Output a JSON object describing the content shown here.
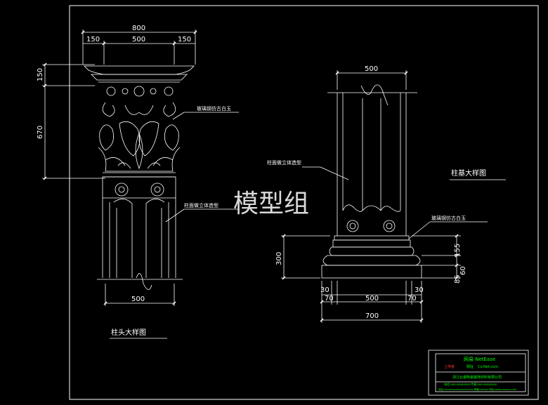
{
  "watermark": "模型组",
  "capital": {
    "dims_top": {
      "total": "800",
      "left": "150",
      "center": "500",
      "right": "150"
    },
    "dims_left": {
      "top": "150",
      "bottom": "670"
    },
    "dim_bottom": "500",
    "note_ornament": "玻璃钢仿古白玉",
    "note_shaft": "柱面做立体造型",
    "title": "柱头大样图"
  },
  "base": {
    "dim_top": "500",
    "note_shaft": "柱面做立体造型",
    "note_ring": "玻璃钢仿古白玉",
    "dims_right": {
      "a": "155",
      "b": "60",
      "c": "85"
    },
    "dim_left": "300",
    "dims_bottom_row1": {
      "l": "30",
      "r": "30"
    },
    "dims_bottom_row2": {
      "l": "70",
      "c": "500",
      "r": "70"
    },
    "dim_bottom_total": "700",
    "title": "柱基大样图"
  },
  "title_block": {
    "brand": "网易 NetEase",
    "line_a_left": "上传者",
    "line_a_mid": "网址",
    "line_a_right": "Co.Net.com",
    "line_b": "浙江云瓷陶瓷装饰材料有限公司",
    "line_c": "电话:xxx-xxxxxxxx  传真:xxx-xxxxxxxx",
    "line_d": "地址:xxxxxxxxxxxxxxxxxxxx  邮编:xxxxxx  网址:www.xxxxxx.com"
  },
  "colors": {
    "background": "#000000",
    "line": "#ffffff",
    "titleblock_green": "#00ff00",
    "titleblock_red": "#ff3333"
  }
}
